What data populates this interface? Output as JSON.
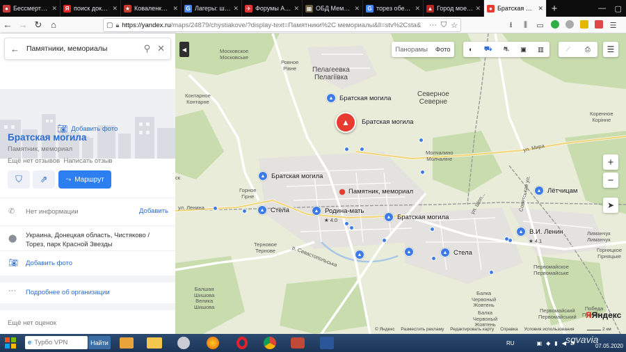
{
  "browser": {
    "tabs": [
      {
        "title": "Бессмертный п",
        "fav": "#c83a3a",
        "glyph": "●"
      },
      {
        "title": "поиск документ",
        "fav": "#e5221b",
        "glyph": "Я"
      },
      {
        "title": "Коваленко Леон",
        "fav": "#c0392b",
        "glyph": "★"
      },
      {
        "title": "Лагеры: шталаг",
        "fav": "#4285f4",
        "glyph": "G"
      },
      {
        "title": "Форумы Авиаци",
        "fav": "#d33",
        "glyph": "✈"
      },
      {
        "title": "ОБД Мемориал",
        "fav": "#6a5b3e",
        "glyph": "▦"
      },
      {
        "title": "торез обелиск",
        "fav": "#4285f4",
        "glyph": "G"
      },
      {
        "title": "Город моего дет",
        "fav": "#b7261f",
        "glyph": "▲"
      },
      {
        "title": "Братская моги",
        "fav": "#e63b2e",
        "glyph": "●",
        "active": true
      }
    ],
    "url_host": "https://yandex.ru",
    "url_path": "/maps/24879/chystiakove/?display-text=Памятники%2C мемориалы&ll=stv%2Csta&"
  },
  "panel": {
    "search_query": "Памятники, мемориалы",
    "add_photo_top": "Добавить фото",
    "title": "Братская могила",
    "subtitle": "Памятник, мемориал",
    "no_reviews": "Ещё нет отзывов",
    "write_review": "Написать отзыв",
    "route_label": "Маршрут",
    "phone_text": "Нет информации",
    "phone_link": "Добавить",
    "address": "Украина, Донецкая область, Чистяково / Торез, парк Красной Звезды",
    "add_photo": "Добавить фото",
    "more_info": "Подробнее об организации",
    "no_ratings": "Ещё нет оценок"
  },
  "map": {
    "tabs": [
      "Панорамы",
      "Фото"
    ],
    "places": {
      "moskovskoe": [
        "Московское",
        "Московське"
      ],
      "rovnoe": [
        "Ровное",
        "Рiвне"
      ],
      "pelageevka": [
        "Пелагеевка",
        "Пелагiївка"
      ],
      "kontarnoe": [
        "Контарное",
        "Контарне"
      ],
      "severnoe": [
        "Северное",
        "Северне"
      ],
      "molchalino": [
        "Молчалино",
        "Молчалiне"
      ],
      "gornoe": [
        "Горное",
        "Гiрне"
      ],
      "ternovoe": [
        "Терновое",
        "Тернове"
      ],
      "balshishova": [
        "Балшая",
        "Шишова",
        "Велика",
        "Шишова"
      ],
      "korennoe": [
        "Коренное",
        "Корiнне"
      ],
      "limanchuk": [
        "Лиманчук",
        "Лиманчук"
      ],
      "gornyatskoe": [
        "Горняцкое",
        "Гiрняцьке"
      ],
      "pervomayskoe": [
        "Первомайское",
        "Первомайське"
      ],
      "balka": [
        "Балка",
        "Червоный",
        "Жовтень"
      ],
      "balka2": [
        "Балка",
        "Червоный",
        "Жовтень"
      ],
      "pervomayskiy": [
        "Первомайский",
        "Первомайський"
      ],
      "pobeda": [
        "Победа",
        "Перемога"
      ],
      "sk": [
        "ск"
      ]
    },
    "roads": {
      "mira": "ул. Мира",
      "lenina": "ул. Ленина",
      "sevastopolskaya": "р. Севастопольська",
      "sovetskaya": "Советськая ул.",
      "shopvskaya": "ул. Шоп..."
    },
    "pois": [
      {
        "key": "bm1",
        "label": "Братская могила"
      },
      {
        "key": "sel",
        "label": "Братская могила"
      },
      {
        "key": "bm2",
        "label": "Братская могила"
      },
      {
        "key": "pm",
        "label": "Памятник, мемориал"
      },
      {
        "key": "stela1",
        "label": "Стела"
      },
      {
        "key": "rodina",
        "label": "Родина-мать",
        "rating": "★ 4.0"
      },
      {
        "key": "bm3",
        "label": "Братская могила"
      },
      {
        "key": "stela2",
        "label": "Стела"
      },
      {
        "key": "letch",
        "label": "Лётчицам"
      },
      {
        "key": "lenin",
        "label": "В.И. Ленин",
        "rating": "★ 4.1"
      }
    ],
    "copyright": [
      "© Яндекс",
      "Разместить рекламу",
      "Редактировать карту",
      "Справка",
      "Условия использования"
    ],
    "logo": "Яндекс",
    "scale": "2 км",
    "zoom_in": "+",
    "zoom_out": "−"
  },
  "taskbar": {
    "search_placeholder": "Турбо VPN",
    "search_button": "Найти",
    "lang": "RU",
    "date": "07.05.2020",
    "watermark": "sgvavia"
  }
}
